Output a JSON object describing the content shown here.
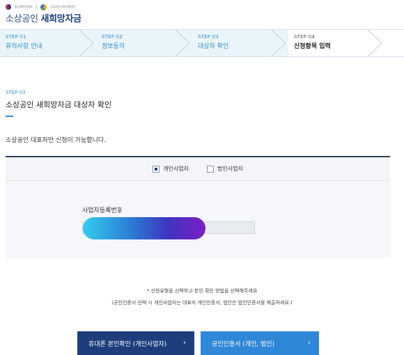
{
  "header": {
    "ministry_logo_text": "중소벤처기업부",
    "agency_logo_text": "소상공인시장진흥공단",
    "brand_prefix": "소상공인",
    "brand_name": "새희망자금"
  },
  "steps": [
    {
      "num": "STEP 01",
      "label": "유의사항 안내",
      "state": "done"
    },
    {
      "num": "STEP 02",
      "label": "정보동의",
      "state": "done"
    },
    {
      "num": "STEP 03",
      "label": "대상자 확인",
      "state": "done"
    },
    {
      "num": "STEP 04",
      "label": "신청항목 입력",
      "state": "current"
    }
  ],
  "section": {
    "step": "STEP 03",
    "title": "소상공인 새희망자금 대상자 확인",
    "notice": "소상공인 대표자만 신청이 가능합니다."
  },
  "form": {
    "options": [
      {
        "label": "개인사업자",
        "checked": true
      },
      {
        "label": "법인사업자",
        "checked": false
      }
    ],
    "field_label": "사업자등록번호"
  },
  "instructions": {
    "line1": "* 신청유형을 선택하고 본인 확인 방법을 선택해주세요",
    "line2": "(공인인증서 선택 시 개인사업자는 대표자 개인인증서, 법인은 법인인증서를 제출하세요.)"
  },
  "buttons": {
    "phone_label": "휴대폰 본인확인 (개인사업자)",
    "cert_label": "공인인증서 (개인, 법인)",
    "arrow": "›"
  },
  "colors": {
    "primary_dark": "#1d3d7c",
    "primary_light": "#2f87d8",
    "step_accent": "#2f8fc9",
    "step_done_bg": "#eaf5fb"
  }
}
